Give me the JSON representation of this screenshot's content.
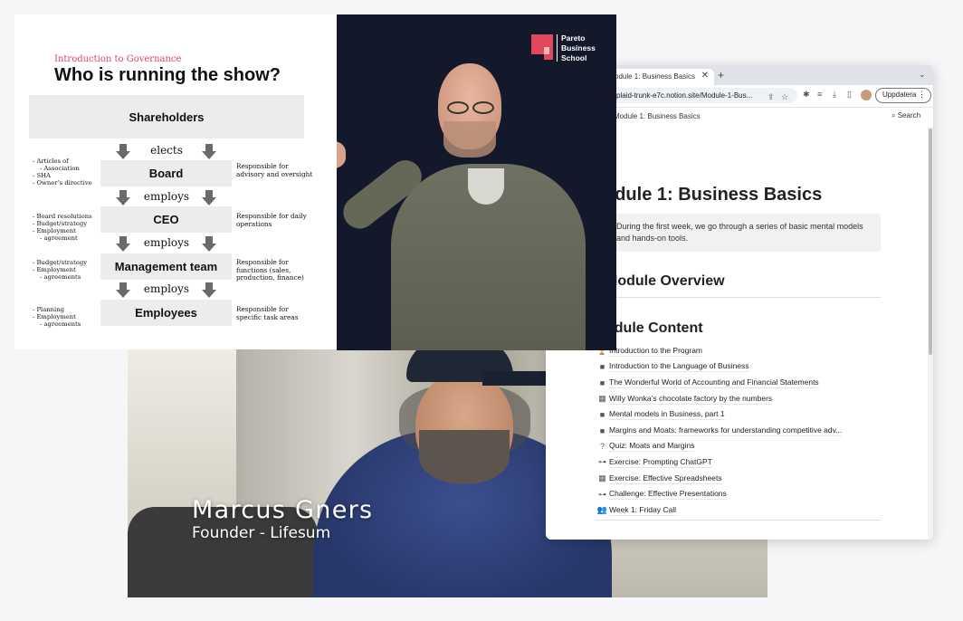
{
  "slide": {
    "kicker": "Introduction to Governance",
    "heading": "Who is running the show?",
    "boxes": {
      "shareholders": "Shareholders",
      "board": "Board",
      "ceo": "CEO",
      "management": "Management team",
      "employees": "Employees"
    },
    "verbs": [
      "elects",
      "employs",
      "employs",
      "employs"
    ],
    "left_lists": [
      [
        "Articles of",
        "Association",
        "SHA",
        "Owner’s directive"
      ],
      [
        "Board resolutions",
        "Budget/strategy",
        "Employment",
        "agreement"
      ],
      [
        "Budget/strategy",
        "Employment",
        "agreements"
      ],
      [
        "Planning",
        "Employment",
        "agreements"
      ]
    ],
    "right_notes": [
      "Responsible for advisory and oversight",
      "Responsible for daily operations",
      "Responsible for functions (sales, production, finance)",
      "Responsible for specific task areas"
    ]
  },
  "presenter_video": {
    "logo_lines": [
      "Pareto",
      "Business",
      "School"
    ],
    "brand_color": "#e0485e",
    "background": "#13192a"
  },
  "interview_video": {
    "name": "Marcus Gners",
    "role": "Founder - Lifesum"
  },
  "browser": {
    "tab_title": "odule 1: Business Basics",
    "url": "plaid-trunk-e7c.notion.site/Module-1-Bus...",
    "update_button": "Uppdatera",
    "breadcrumb": "Module 1: Business Basics",
    "search_label": "Search",
    "page_title": "odule 1: Business Basics",
    "callout": "During the first week, we go through a series of basic mental models and hands-on tools.",
    "h_overview": "Module Overview",
    "h_content": "odule Content",
    "lessons": [
      {
        "icon": "trophy-icon",
        "glyph": "🏆",
        "label": "Introduction to the Program"
      },
      {
        "icon": "video-icon",
        "glyph": "■",
        "label": "Introduction to the Language of Business"
      },
      {
        "icon": "video-icon",
        "glyph": "■",
        "label": "The Wonderful World of Accounting and Financial Statements"
      },
      {
        "icon": "table-icon",
        "glyph": "▦",
        "label": "Willy Wonka’s chocolate factory by the numbers"
      },
      {
        "icon": "video-icon",
        "glyph": "■",
        "label": "Mental models in Business, part 1"
      },
      {
        "icon": "video-icon",
        "glyph": "■",
        "label": "Margins and Moats: frameworks for understanding competitive adv..."
      },
      {
        "icon": "quiz-icon",
        "glyph": "?",
        "label": "Quiz: Moats and Margins"
      },
      {
        "icon": "dumbbell-icon",
        "glyph": "⊶",
        "label": "Exercise: Prompting ChatGPT"
      },
      {
        "icon": "table-icon",
        "glyph": "▦",
        "label": "Exercise: Effective Spreadsheets"
      },
      {
        "icon": "dumbbell-icon",
        "glyph": "⊶",
        "label": "Challenge: Effective Presentations"
      },
      {
        "icon": "people-icon",
        "glyph": "👥",
        "label": "Week 1: Friday Call"
      }
    ]
  }
}
